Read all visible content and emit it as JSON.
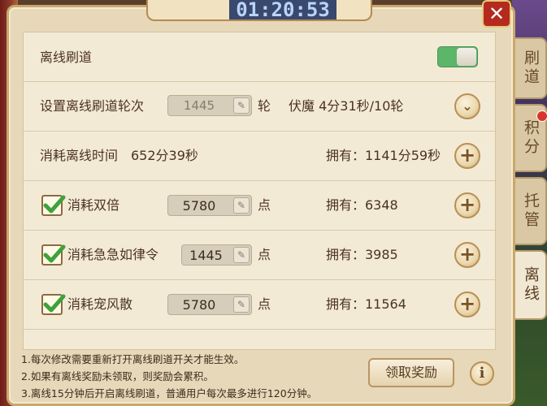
{
  "header": {
    "timer": "01:20:53",
    "title_fragment": "刷道",
    "close_label": "✕"
  },
  "side_tabs": [
    {
      "label": "刷道",
      "active": false
    },
    {
      "label": "积分",
      "active": false,
      "badge": true
    },
    {
      "label": "托管",
      "active": false
    },
    {
      "label": "离线",
      "active": true
    }
  ],
  "offline": {
    "label": "离线刷道",
    "toggle_on": true
  },
  "rounds": {
    "label": "设置离线刷道轮次",
    "input_value": "1445",
    "unit": "轮",
    "summary": "伏魔 4分31秒/10轮"
  },
  "time": {
    "label": "消耗离线时间",
    "value": "652分39秒",
    "owned": "拥有：1141分59秒"
  },
  "items": [
    {
      "label": "消耗双倍",
      "checked": true,
      "value": "5780",
      "unit": "点",
      "owned": "拥有：6348"
    },
    {
      "label": "消耗急急如律令",
      "checked": true,
      "value": "1445",
      "unit": "点",
      "owned": "拥有：3985"
    },
    {
      "label": "消耗宠风散",
      "checked": true,
      "value": "5780",
      "unit": "点",
      "owned": "拥有：11564"
    }
  ],
  "notes": [
    "1.每次修改需要重新打开离线刷道开关才能生效。",
    "2.如果有离线奖励未领取，则奖励会累积。",
    "3.离线15分钟后开启离线刷道，普通用户每次最多进行120分钟。"
  ],
  "claim_button": "领取奖励",
  "info_icon": "i",
  "colors": {
    "toggle_on": "#5cb66a",
    "accent_brown": "#b98f55",
    "close_red": "#b52a1f"
  }
}
